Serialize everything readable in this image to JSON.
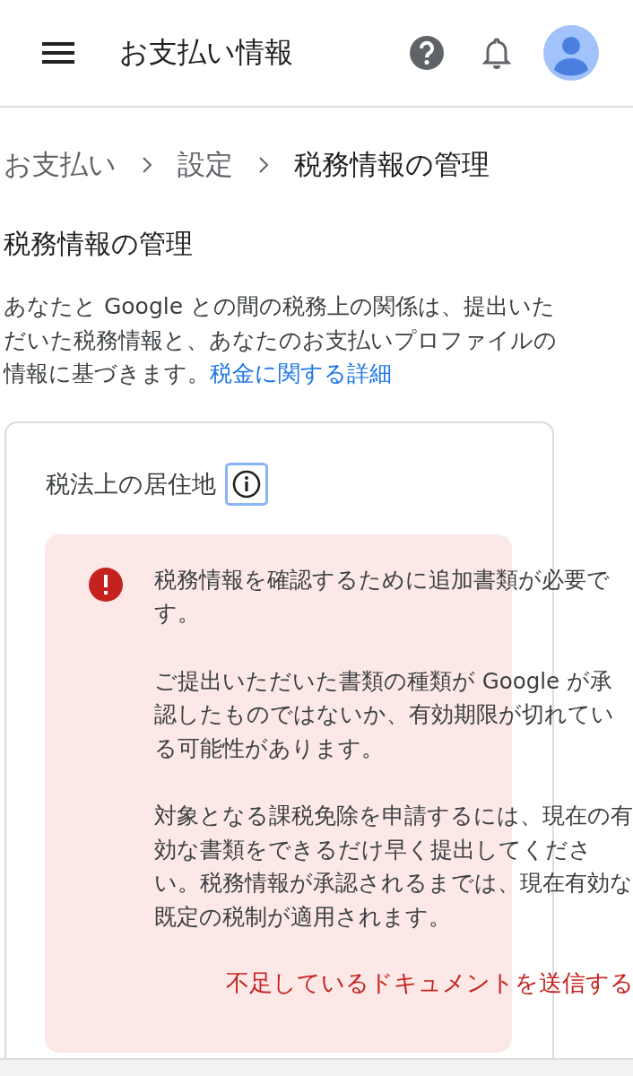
{
  "app_bar": {
    "title": "お支払い情報"
  },
  "breadcrumb": [
    "お支払い",
    "設定",
    "税務情報の管理"
  ],
  "heading": "税務情報の管理",
  "intro": {
    "text": "あなたと Google との間の税務上の関係は、提出いただいた税務情報と、あなたのお支払いプロファイルの情報に基づきます。",
    "link": "税金に関する詳細"
  },
  "card": {
    "title": "税法上の居住地",
    "alert": {
      "kind": "error",
      "paragraphs": [
        "税務情報を確認するために追加書類が必要です。",
        "ご提出いただいた書類の種類が Google が承認したものではないか、有効期限が切れている可能性があります。",
        "対象となる課税免除を申請するには、現在の有効な書類をできるだけ早く提出してください。税務情報が承認されるまでは、現在有効な既定の税制が適用されます。"
      ],
      "action": "不足しているドキュメントを送信する"
    }
  }
}
